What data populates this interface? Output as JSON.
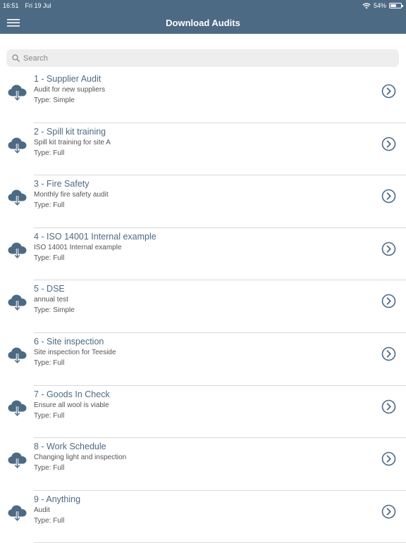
{
  "status_bar": {
    "time": "16:51",
    "date": "Fri 19 Jul",
    "battery": "54%",
    "battery_level": 0.54
  },
  "nav": {
    "title": "Download Audits",
    "menu_icon": "hamburger-menu-icon"
  },
  "search": {
    "placeholder": "Search",
    "value": ""
  },
  "audits": [
    {
      "title": "1 - Supplier Audit",
      "description": "Audit for new suppliers",
      "type": "Type: Simple"
    },
    {
      "title": "2 - Spill kit training",
      "description": "Spill kit training for site A",
      "type": "Type: Full"
    },
    {
      "title": "3 - Fire Safety",
      "description": "Monthly fire safety audit",
      "type": "Type: Full"
    },
    {
      "title": "4 - ISO 14001 Internal example",
      "description": "ISO 14001 Internal example",
      "type": "Type: Full"
    },
    {
      "title": "5 - DSE",
      "description": "annual test",
      "type": "Type: Simple"
    },
    {
      "title": "6 - Site inspection",
      "description": "Site inspection for Teeside",
      "type": "Type: Full"
    },
    {
      "title": "7 - Goods In Check",
      "description": "Ensure all wool is viable",
      "type": "Type: Full"
    },
    {
      "title": "8 - Work Schedule",
      "description": "Changing light and inspection",
      "type": "Type: Full"
    },
    {
      "title": "9 - Anything",
      "description": "Audit",
      "type": "Type: Full"
    }
  ],
  "colors": {
    "brand": "#4d6a84",
    "search_bg": "#eeeeef",
    "divider": "#d9d9de"
  },
  "icons": {
    "row_leading": "cloud-download-icon",
    "row_trailing": "chevron-right-circle-icon",
    "search": "search-icon"
  }
}
